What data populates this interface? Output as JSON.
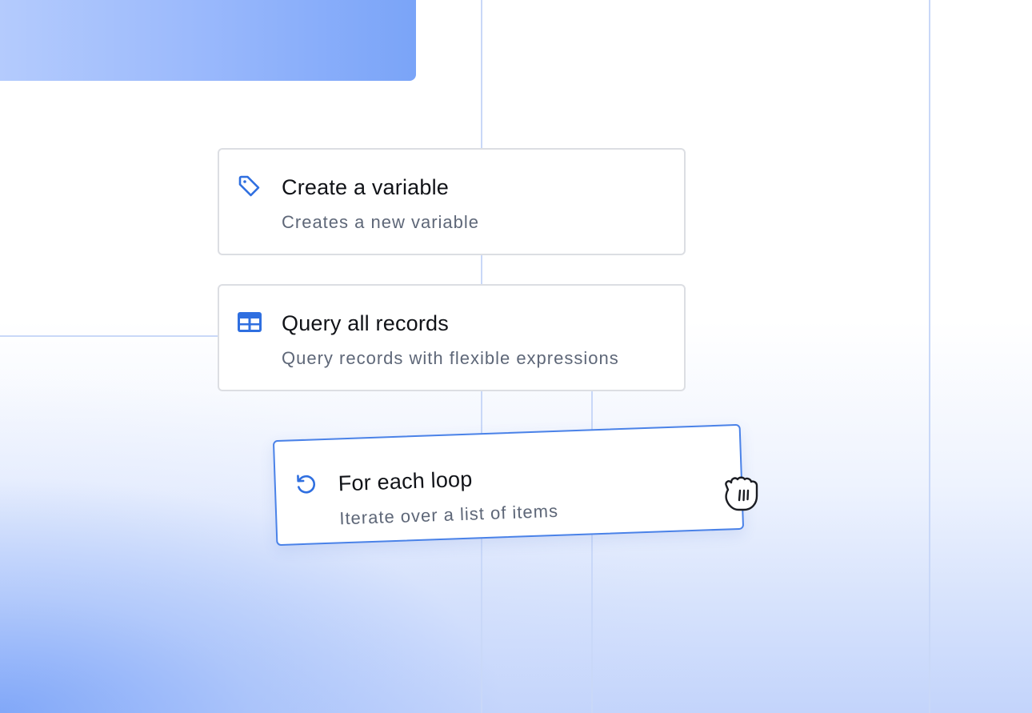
{
  "actions": [
    {
      "title": "Create a variable",
      "subtitle": "Creates a new variable",
      "icon": "tag-icon"
    },
    {
      "title": "Query all records",
      "subtitle": "Query records with flexible expressions",
      "icon": "table-icon"
    },
    {
      "title": "For each loop",
      "subtitle": "Iterate over a list of items",
      "icon": "loop-icon",
      "state": "dragging"
    }
  ],
  "colors": {
    "accent": "#2f6fe0",
    "drag_border": "#4a82e8",
    "card_border": "#dcdee3",
    "connector": "#c9d8f8",
    "title_text": "#111318",
    "subtitle_text": "#5e6778"
  },
  "cursor": "grab-hand-icon"
}
